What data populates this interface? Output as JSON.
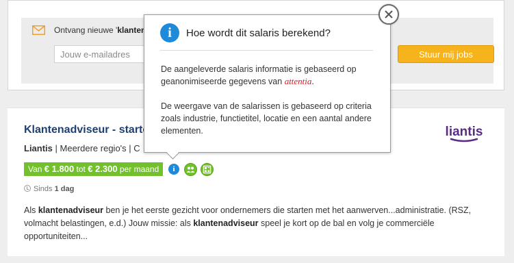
{
  "alert": {
    "text_prefix": "Ontvang nieuwe '",
    "keyword": "klantenad",
    "email_placeholder": "Jouw e-mailadres",
    "submit_label": "Stuur mij jobs"
  },
  "job": {
    "title": "Klantenadviseur - starte",
    "company": "Liantis",
    "separator": " | ",
    "region": "Meerdere regio's",
    "region_sep": " | ",
    "region_more": "C",
    "logo_text": "liantis",
    "salary": {
      "prefix": "Van ",
      "min": "€ 1.800",
      "mid": " tot ",
      "max": "€ 2.300",
      "suffix": " per maand"
    },
    "info_glyph": "i",
    "posted_prefix": "Sinds ",
    "posted_value": "1 dag",
    "description": {
      "p1": "Als ",
      "b1": "klantenadviseur",
      "p2": " ben je het eerste gezicht voor ondernemers die starten met het aanwerven...administratie. (RSZ, volmacht belastingen, e.d.) Jouw missie: als ",
      "b2": "klantenadviseur",
      "p3": " speel je kort op de bal en volg je commerciële opportuniteiten..."
    }
  },
  "popover": {
    "icon_glyph": "i",
    "title": "Hoe wordt dit salaris berekend?",
    "paragraph1": "De aangeleverde salaris informatie is gebaseerd op geanonimiseerde gegevens van ",
    "brand": "attentia",
    "paragraph1_end": ".",
    "paragraph2": "De weergave van de salarissen is gebaseerd op criteria zoals industrie, functietitel, locatie en een aantal andere elementen."
  },
  "colors": {
    "accent_green": "#72c02c",
    "info_blue": "#1f8ad8",
    "button_orange": "#f6b31b",
    "title_navy": "#1c3f74",
    "brand_red": "#c8202f",
    "logo_purple": "#5b2c83"
  },
  "icons": {
    "alert": "envelope-icon",
    "info": "info-icon",
    "salary_icon_1": "people-icon",
    "salary_icon_2": "calculator-icon",
    "posted": "clock-icon",
    "close": "close-icon"
  }
}
